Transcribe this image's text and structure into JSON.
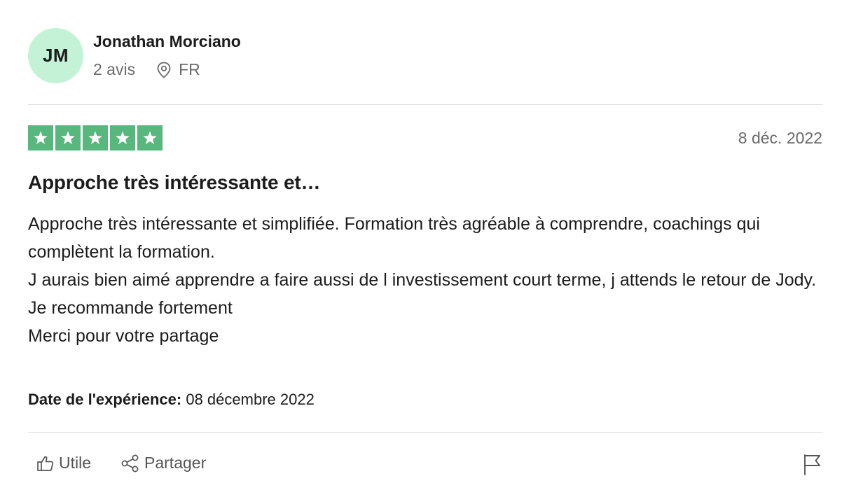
{
  "consumer": {
    "initials": "JM",
    "name": "Jonathan Morciano",
    "reviews_count": "2 avis",
    "country": "FR",
    "avatar_color": "#c3f2d6"
  },
  "review": {
    "rating": 5,
    "rating_max": 5,
    "star_color": "#57b77c",
    "date": "8 déc. 2022",
    "title": "Approche très intéressante et…",
    "body_lines": [
      "Approche très intéressante et simplifiée. Formation très agréable à comprendre, coachings qui complètent la formation.",
      "J aurais bien aimé apprendre a faire aussi de l investissement court terme, j attends le retour de Jody.",
      "Je recommande fortement",
      "Merci pour votre partage"
    ],
    "experience_label": "Date de l'expérience:",
    "experience_date": "08 décembre 2022"
  },
  "actions": {
    "useful_label": "Utile",
    "useful_icon": "thumbs-up-icon",
    "share_label": "Partager",
    "share_icon": "share-icon",
    "report_icon": "flag-icon"
  }
}
